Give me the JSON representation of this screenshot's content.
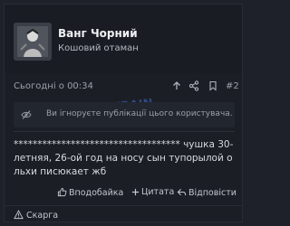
{
  "author": {
    "name": "Ванг Чорний",
    "title": "Кошовий отаман",
    "avatar_icon": "avatar-image"
  },
  "post": {
    "date": "Сьогодні о 00:34",
    "number": "#2",
    "ignore_notice": "Ви ігноруєте публікації цього користувача.",
    "message": "*********************************** чушка 30-летняя, 26-ой год на носу сын тупорылой ольхи писюкает жб"
  },
  "actions": {
    "like": "Вподобайка",
    "quote": "Цитата",
    "reply": "Відповісти"
  },
  "footer": {
    "report": "Скарга"
  },
  "icons": {
    "arrow": "arrow-up-icon",
    "share": "share-icon",
    "bookmark": "bookmark-icon",
    "hide": "eye-off-icon",
    "like": "thumbs-up-icon",
    "quote": "plus-icon",
    "reply": "reply-icon",
    "report": "warning-icon"
  },
  "colors": {
    "background": "#1e2129",
    "accent_text": "#f0f1f4"
  }
}
